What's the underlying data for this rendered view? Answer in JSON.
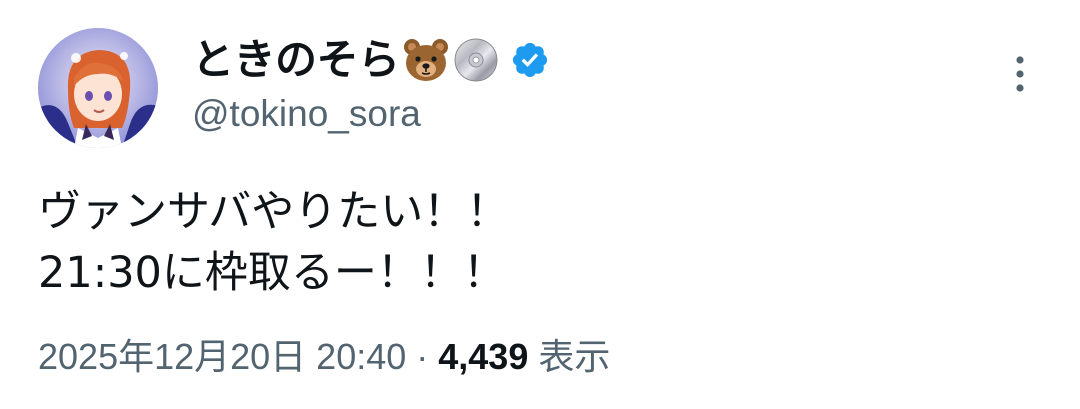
{
  "author": {
    "display_name": "ときのそら",
    "name_emojis": [
      "bear-face-icon",
      "optical-disc-icon"
    ],
    "verified": true,
    "handle": "@tokino_sora"
  },
  "tweet": {
    "lines": [
      "ヴァンサバやりたい！！",
      "21:30に枠取るー！！！"
    ],
    "timestamp": "2025年12月20日 20:40",
    "separator": "·",
    "views_count": "4,439",
    "views_label": "表示"
  },
  "colors": {
    "text_primary": "#0f1419",
    "text_secondary": "#536471",
    "verified_blue": "#1d9bf0"
  }
}
